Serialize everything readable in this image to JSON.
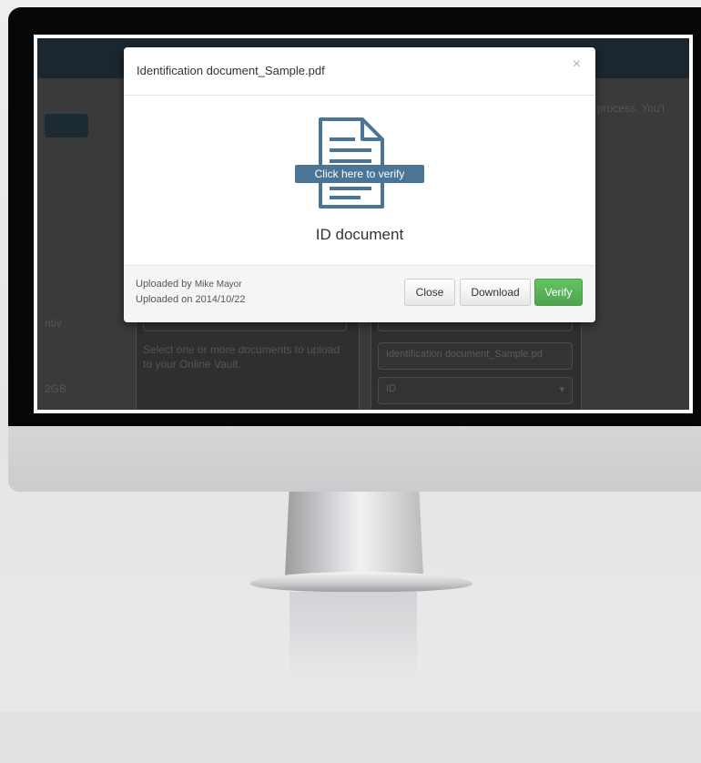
{
  "modal": {
    "title": "Identification document_Sample.pdf",
    "close_symbol": "×",
    "verify_banner": "Click here to verify",
    "document_label": "ID document",
    "uploaded_by_label": "Uploaded by",
    "uploaded_by_name": "Mike Mayor",
    "uploaded_on_label": "Uploaded on",
    "uploaded_on_date": "2014/10/22",
    "buttons": {
      "close": "Close",
      "download": "Download",
      "verify": "Verify"
    },
    "icon": "document-icon"
  },
  "background_app": {
    "notice_fragment": "process. You'l",
    "left_fragment_1": "ntiv",
    "left_fragment_2": "2GB",
    "upload_hint": "Select one or more documents to upload to your Online Vault.",
    "file_name_field": "Identification document_Sample.pd",
    "document_type_select": "ID"
  },
  "colors": {
    "verify_green": "#5cb85c",
    "banner_blue": "#4a7596",
    "icon_blue": "#4a7596"
  }
}
